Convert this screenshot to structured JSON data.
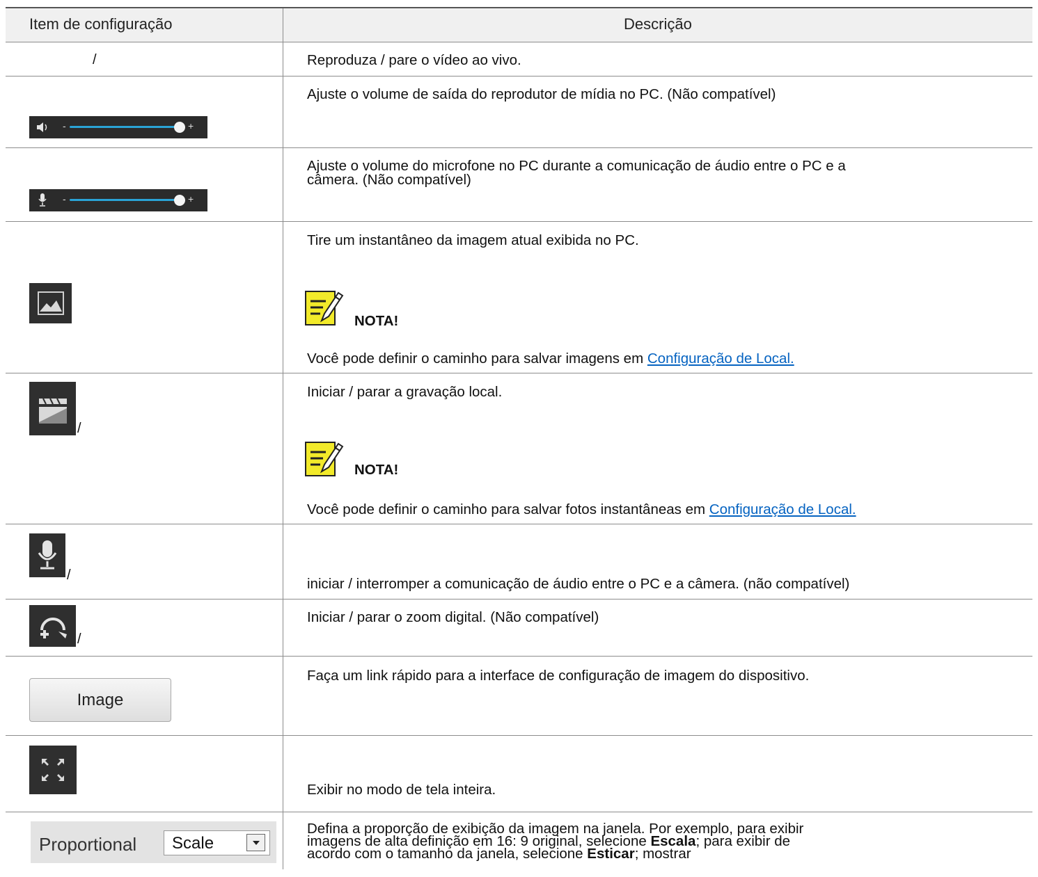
{
  "table": {
    "headers": {
      "item": "Item de configuração",
      "description": "Descrição"
    },
    "rows": [
      {
        "item_text": "/",
        "description": "Reproduza / pare o vídeo ao vivo."
      },
      {
        "item_icon": "speaker-volume-slider-icon",
        "description": "Ajuste o volume de saída do reprodutor de mídia no PC. (Não compatível)"
      },
      {
        "item_icon": "microphone-volume-slider-icon",
        "description_line1": "Ajuste o volume do microfone no PC durante a comunicação de áudio entre o PC e a",
        "description_line2": "câmera. (Não compatível)"
      },
      {
        "item_icon": "snapshot-icon",
        "description": "Tire um instantâneo da imagem atual exibida no PC.",
        "note_label": "NOTA!",
        "note_text": "Você pode definir o caminho para salvar imagens em ",
        "note_link": "Configuração de Local."
      },
      {
        "item_icon": "record-icon",
        "slash": "/",
        "description": "Iniciar / parar a gravação local.",
        "note_label": "NOTA!",
        "note_text": "Você pode definir o caminho para salvar fotos instantâneas em ",
        "note_link": "Configuração de Local."
      },
      {
        "item_icon": "microphone-icon",
        "slash": "/",
        "description": "iniciar / interromper a comunicação de áudio entre o PC e a câmera. (não compatível)"
      },
      {
        "item_icon": "digital-zoom-icon",
        "slash": "/",
        "description": "Iniciar / parar o zoom digital. (Não compatível)"
      },
      {
        "item_button": "Image",
        "description": "Faça um link rápido para a interface de configuração de imagem do dispositivo."
      },
      {
        "item_icon": "fullscreen-icon",
        "description": "Exibir no modo de tela inteira."
      },
      {
        "item_label": "Proportional",
        "item_select": "Scale",
        "description_line1": "Defina a proporção de exibição da imagem na janela. Por exemplo, para exibir",
        "description_line2_a": "imagens de alta definição em 16: 9 original, selecione ",
        "description_line2_b": "Escala",
        "description_line2_c": "; para exibir de",
        "description_line3_a": "acordo com o tamanho da janela, selecione ",
        "description_line3_b": "Esticar",
        "description_line3_c": "; mostrar"
      }
    ]
  },
  "colors": {
    "link": "#0563c1",
    "slider_track": "#2aa3d6",
    "icon_bg": "#2f2f2f",
    "note_yellow": "#f2ea2a"
  }
}
